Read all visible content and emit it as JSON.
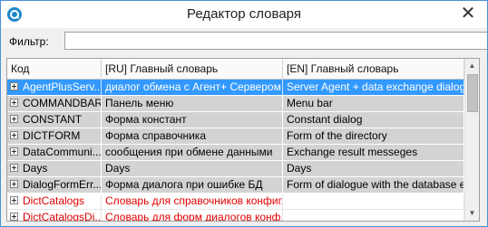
{
  "window": {
    "title": "Редактор словаря",
    "close_glyph": "✕"
  },
  "filter": {
    "label": "Фильтр:",
    "value": ""
  },
  "grid": {
    "columns": [
      "Код",
      "[RU] Главный словарь",
      "[EN] Главный словарь"
    ],
    "rows": [
      {
        "code": "AgentPlusServ...",
        "ru": "диалог обмена с Агент+ Сервером",
        "en": "Server Agent + data exchange dialog",
        "style": "selected"
      },
      {
        "code": "COMMANDBAR",
        "ru": "Панель меню",
        "en": "Menu bar",
        "style": "gray"
      },
      {
        "code": "CONSTANT",
        "ru": "Форма констант",
        "en": "Constant dialog",
        "style": "gray"
      },
      {
        "code": "DICTFORM",
        "ru": "Форма справочника",
        "en": "Form of the directory",
        "style": "gray"
      },
      {
        "code": "DataCommuni...",
        "ru": "сообщения при обмене данными",
        "en": "Exchange result messeges",
        "style": "gray"
      },
      {
        "code": "Days",
        "ru": "Days",
        "en": "Days",
        "style": "gray"
      },
      {
        "code": "DialogFormErr...",
        "ru": "Форма диалога при ошибке БД",
        "en": "Form of dialogue with the database er...",
        "style": "gray"
      },
      {
        "code": "DictCatalogs",
        "ru": "Словарь для справочников конфиг...",
        "en": "",
        "style": "plain"
      },
      {
        "code": "DictCatalogsDi...",
        "ru": "Словарь для форм диалогов конф...",
        "en": "",
        "style": "plain"
      }
    ]
  },
  "scrollbar": {
    "up_glyph": "▲",
    "down_glyph": "▼"
  }
}
